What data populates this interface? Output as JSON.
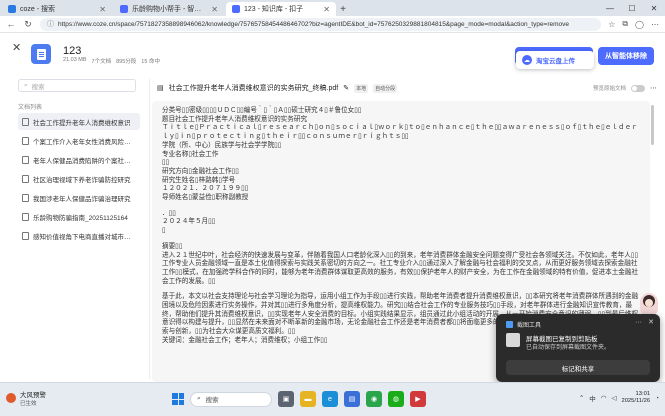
{
  "browser": {
    "tabs": [
      {
        "title": "coze - 搜索",
        "color": "#2a7ae2",
        "active": false
      },
      {
        "title": "乐龄购物小帮手 - 智能体 - 扣子",
        "color": "#4d6bfe",
        "active": false
      },
      {
        "title": "123 - 知识库 - 扣子",
        "color": "#4d6bfe",
        "active": true
      }
    ],
    "new_tab": "+",
    "url": "https://www.coze.cn/space/7571827358898946062/knowledge/7576575845448646702?biz=agentIDE&bot_id=7576250329881804815&page_mode=modal&action_type=remove",
    "window_controls": [
      "—",
      "☐",
      "✕"
    ]
  },
  "knowledge": {
    "name": "123",
    "meta": [
      "21.03 MB",
      "7个文档",
      "895分段",
      "15 命中"
    ],
    "upload_label": "添加内容",
    "popup_label": "淘宝云盘上传",
    "remove_label": "从智能体移除"
  },
  "sidebar": {
    "search_placeholder": "搜索",
    "section_title": "文档列表",
    "items": [
      "社会工作提升老年人消费维权意识",
      "个案工作介入老年女性消费风险认知",
      "老年人保健品消费陷阱的个案社会工作",
      "社区治理视域下养老诈骗防控研究",
      "我国涉老年人保健品诈骗治理研究",
      "乐龄购物防骗指南_20251125164",
      "感知价值视角下电商直播对城市低龄"
    ]
  },
  "doc": {
    "title": "社会工作提升老年人消费维权意识的实务研究_终稿.pdf",
    "badges": [
      "本地",
      "自动分段"
    ],
    "preview_label": "预览原始文档",
    "paragraphs": [
      "分类号▯▯密级▯▯▯▯ＵＤＣ▯▯编号｀▯｀▯Ａ▯▯硕士研究４▯＃鲁位女▯▯",
      "题目社会工作提升老年人消费维权意识的实务研究",
      "Ｔｉｔｌｅ▯Ｐｒａｃｔｉｃａｌ▯ｒｅｓｅａｒｃｈ▯ｏｎ▯ｓｏｃｉａｌ▯ｗｏｒｋ▯ｔｏ▯ｅｎｈａｎｃｅ▯ｔｈｅ▯▯ａｗａｒｅｎｅｓｓ▯ｏｆ▯ｔｈｅ▯ｅｌｄｅｒｌｙ▯ｉｎ▯ｐｒｏｔｅｃｔｉｎｇ▯ｔｈｅｉｒ▯▯ｃｏｎｓｕｍｅｒ▯ｒｉｇｈｔｓ▯▯",
      "学院（所、中心）民族学与社会学学院▯▯",
      "专业名称▯社会工作",
      "▯▯",
      "研究方向▯金融社会工作▯▯",
      "研究生姓名▯梓路韩▯学号",
      "１２０２１．２０７１９９▯▯",
      "导师姓名▯蒙益俭▯职称副教授",
      "",
      "．▯▯",
      "２０２４年５月▯▯",
      "▯",
      "",
      "摘要▯▯",
      "进入２１世纪中叶，社会经济的快速发展与变革，伴随着我国人口老龄化深入▯▯的到来，老年消费群体金融安全问题变得广受社会各领域关注。不仅如此，老年人▯▯工作专业人员金融领域一直是本土化值得探索与实践关系密切的方向之一。社工专业介入▯▯通过深入了解金融与社会福利的交叉点，从而更好服务领域去探索金融社工作▯▯模式，在加强跨学科合作的同时，能够为老年消费群体谋取更高效的服务，有效▯▯保护老年人的财产安全，为在工作在金融领域的特有价值，促进本土金融社会工作的发展。▯▯",
      "",
      "基于此，本文以社会支持理论与社会学习理论为指导，运用小组工作为手段▯▯进行实践，帮助老年消费者提升消费维权意识，▯▯本研究将老年消费群体所遇到的金融困境以及危险因素进行实务操作，并对其▯▯进行多角度分析，提高维权能力。研究▯▯结合社会工作的专业服务技巧▯▯手段，对老年群体进行金融知识宣传教育，最终，帮助他们提升其消费维权意识，▯▯实现老年人安全消费的目标。小组实践结果显示，组员通过此小组活动的开展，从一开始消费安全意识的薄弱，▯▯到最后维权意识得以构建与提升，▯▯显然在未来面对不断革新的金融市场，无论金融社会工作还是老年消费者都▯▯将面临更多的挑战，因此金融社工在老年消费者维权领域的探索与创新，▯▯为社会大众谋更高质文福利。▯▯",
      "关键词：金融社会工作；老年人；消费维权；小组工作▯▯"
    ]
  },
  "notification": {
    "app": "截图工具",
    "line1": "屏幕截图已复制到剪贴板",
    "line2": "已自动保存到屏幕截图文件夹。",
    "action": "标记和共享",
    "more": "···",
    "close": "✕"
  },
  "taskbar": {
    "weather_title": "大风预警",
    "weather_sub": "已生效",
    "search_placeholder": "搜索",
    "apps": [
      {
        "name": "task-view-icon",
        "color": "#5b6470",
        "glyph": "▣"
      },
      {
        "name": "file-explorer-icon",
        "color": "#e6b422",
        "glyph": "▬"
      },
      {
        "name": "edge-icon",
        "color": "#1a8fd8",
        "glyph": "e"
      },
      {
        "name": "store-icon",
        "color": "#3a6fd8",
        "glyph": "▤"
      },
      {
        "name": "chrome-icon",
        "color": "#2aa54b",
        "glyph": "◉"
      },
      {
        "name": "wechat-icon",
        "color": "#1aad19",
        "glyph": "◍"
      },
      {
        "name": "media-icon",
        "color": "#d03a3a",
        "glyph": "▶"
      }
    ],
    "tray_lang": "中",
    "time": "13:01",
    "date": "2025/11/26"
  }
}
